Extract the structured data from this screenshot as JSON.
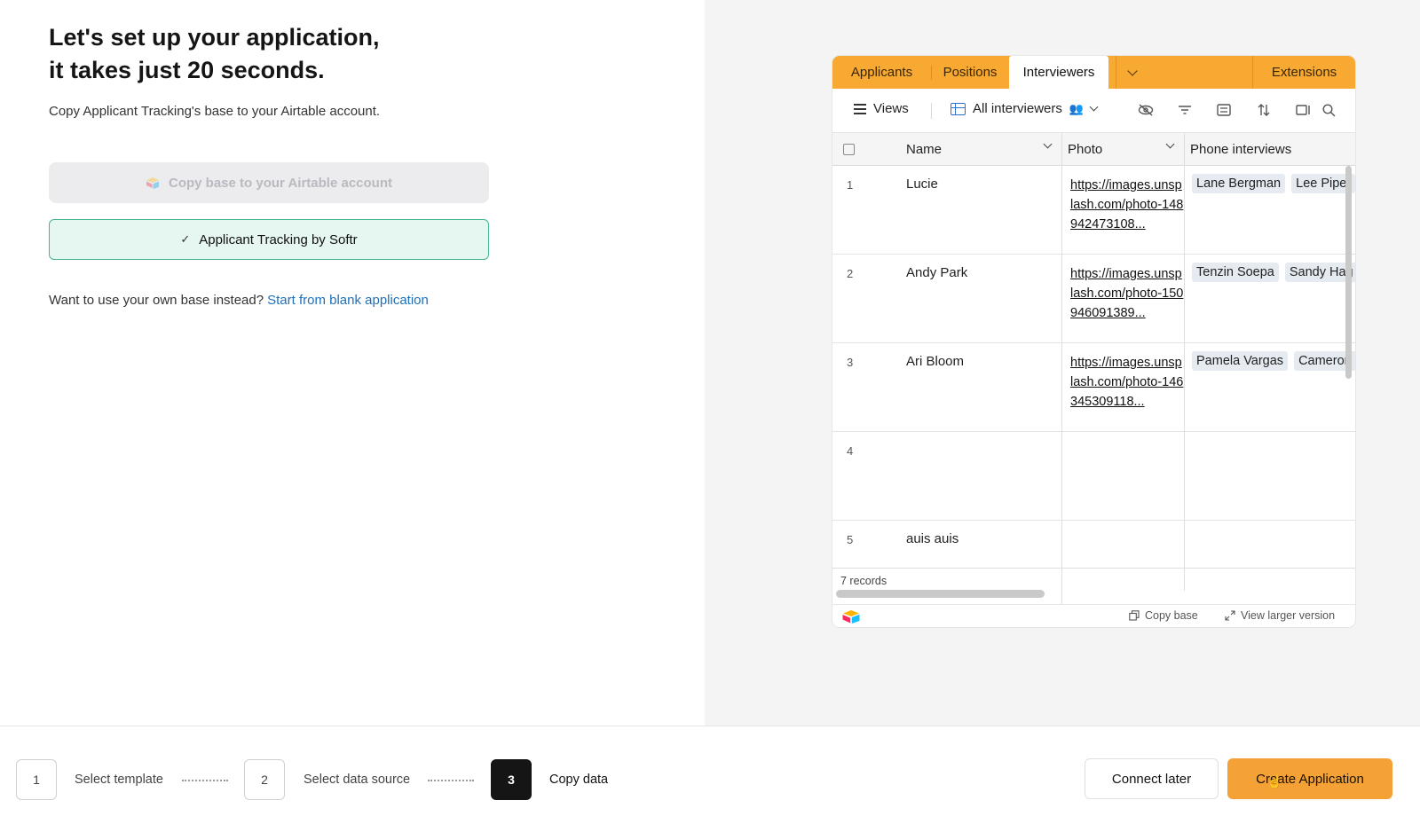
{
  "left": {
    "title_line1": "Let's set up your application,",
    "title_line2": "it takes just 20 seconds.",
    "subtitle": "Copy Applicant Tracking's base to your Airtable account.",
    "copy_button_label": "Copy base to your Airtable account",
    "selected_base_label": "Applicant Tracking by Softr",
    "own_base_prompt": "Want to use your own base instead?",
    "own_base_link": "Start from blank application"
  },
  "embed": {
    "tabs": [
      "Applicants",
      "Positions",
      "Interviewers"
    ],
    "active_tab": "Interviewers",
    "extensions_label": "Extensions",
    "views_label": "Views",
    "view_name": "All interviewers",
    "columns": [
      "Name",
      "Photo",
      "Phone interviews"
    ],
    "rows": [
      {
        "num": "1",
        "name": "Lucie",
        "photo": "https://images.unsplash.com/photo-148942473108...",
        "chips": [
          "Lane Bergman",
          "Lee Piper"
        ]
      },
      {
        "num": "2",
        "name": "Andy Park",
        "photo": "https://images.unsplash.com/photo-150946091389...",
        "chips": [
          "Tenzin Soepa",
          "Sandy Hag"
        ]
      },
      {
        "num": "3",
        "name": "Ari Bloom",
        "photo": "https://images.unsplash.com/photo-146345309118...",
        "chips": [
          "Pamela Vargas",
          "Cameron"
        ]
      },
      {
        "num": "4",
        "name": "",
        "photo": "",
        "chips": []
      },
      {
        "num": "5",
        "name": "auis auis",
        "photo": "",
        "chips": []
      }
    ],
    "records_label": "7 records",
    "copy_base_label": "Copy base",
    "view_larger_label": "View larger version"
  },
  "steps": [
    {
      "num": "1",
      "label": "Select template",
      "active": false
    },
    {
      "num": "2",
      "label": "Select data source",
      "active": false
    },
    {
      "num": "3",
      "label": "Copy data",
      "active": true
    }
  ],
  "actions": {
    "connect_later": "Connect later",
    "create_application": "Create Application"
  },
  "colors": {
    "accent": "#f4a236",
    "tabbar": "#f7a932",
    "selected_border": "#45b58a",
    "link": "#1f6fba"
  }
}
